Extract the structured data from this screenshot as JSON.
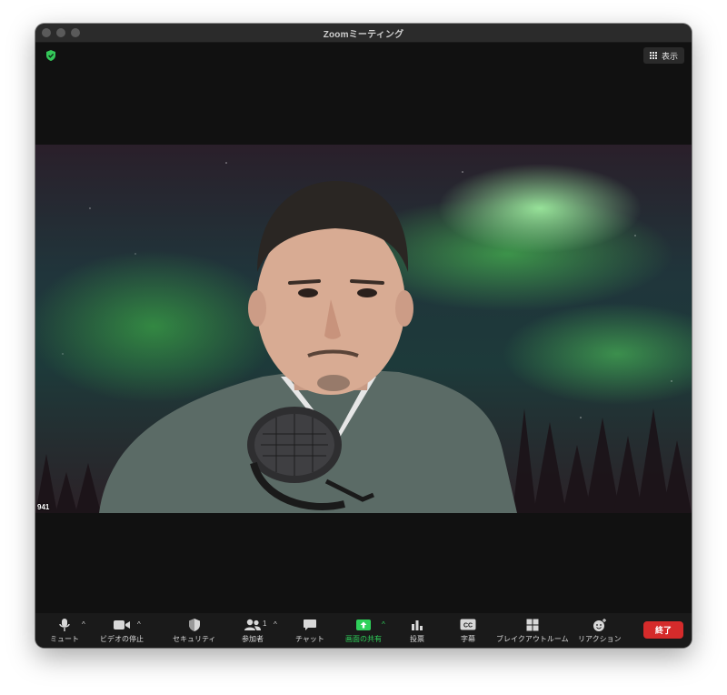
{
  "window": {
    "title": "Zoomミーティング"
  },
  "view_button": {
    "label": "表示"
  },
  "video": {
    "participant_name": "941"
  },
  "toolbar": {
    "mute": "ミュート",
    "stop_video": "ビデオの停止",
    "security": "セキュリティ",
    "participants": "参加者",
    "participants_count": "1",
    "chat": "チャット",
    "share_screen": "画面の共有",
    "polls": "投票",
    "captions": "字幕",
    "captions_icon_text": "CC",
    "breakout_rooms": "ブレイクアウトルーム",
    "reactions": "リアクション",
    "end": "終了",
    "caret": "^"
  },
  "colors": {
    "share_green": "#2fd05a",
    "end_red": "#d52b2b",
    "shield_green": "#34c759"
  }
}
